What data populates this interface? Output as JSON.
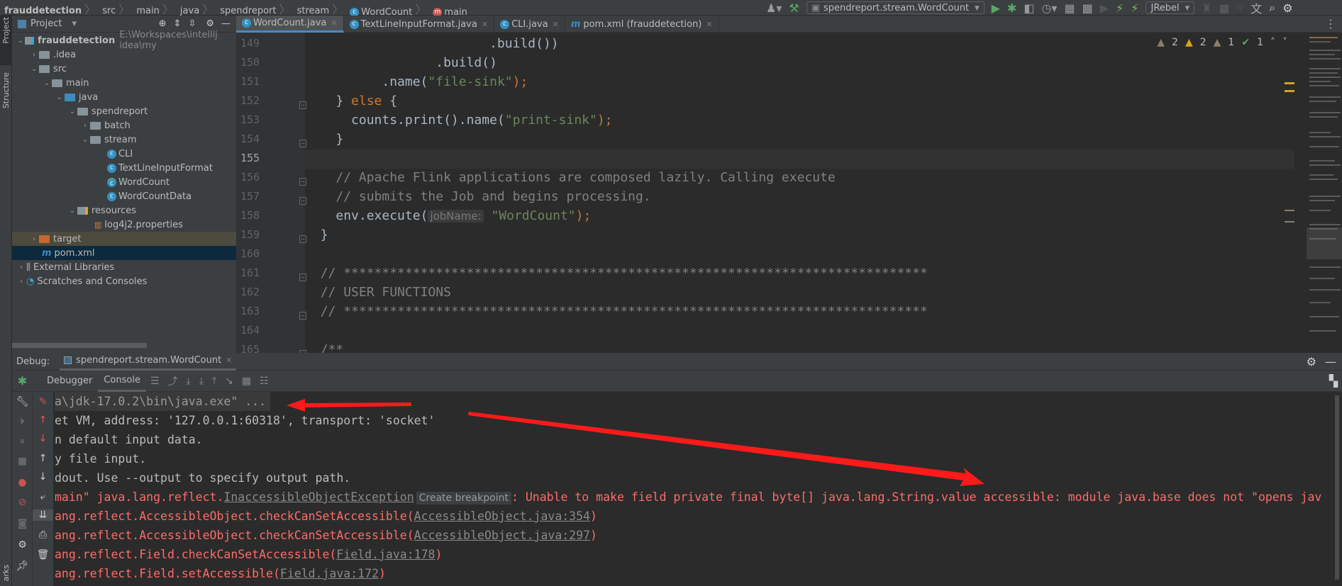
{
  "breadcrumb": [
    "frauddetection",
    "src",
    "main",
    "java",
    "spendreport",
    "stream",
    "WordCount",
    "main"
  ],
  "toolbar": {
    "run_config": "spendreport.stream.WordCount",
    "jrebel": "JRebel"
  },
  "sidebar": {
    "project_label": "Project",
    "structure_label": "Structure",
    "bookmarks_label": "arks"
  },
  "project": {
    "title": "Project",
    "tree": [
      {
        "label": "frauddetection",
        "path": "E:\\Workspaces\\intellij idea\\my"
      },
      {
        "label": ".idea"
      },
      {
        "label": "src"
      },
      {
        "label": "main"
      },
      {
        "label": "java"
      },
      {
        "label": "spendreport"
      },
      {
        "label": "batch"
      },
      {
        "label": "stream"
      },
      {
        "label": "CLI"
      },
      {
        "label": "TextLineInputFormat"
      },
      {
        "label": "WordCount"
      },
      {
        "label": "WordCountData"
      },
      {
        "label": "resources"
      },
      {
        "label": "log4j2.properties"
      },
      {
        "label": "target"
      },
      {
        "label": "pom.xml"
      },
      {
        "label": "External Libraries"
      },
      {
        "label": "Scratches and Consoles"
      }
    ]
  },
  "tabs": [
    {
      "label": "WordCount.java",
      "active": true
    },
    {
      "label": "TextLineInputFormat.java"
    },
    {
      "label": "CLI.java"
    },
    {
      "label": "pom.xml (frauddetection)"
    }
  ],
  "inspections": {
    "warn1": "2",
    "warn2": "2",
    "weak": "1",
    "typo": "1"
  },
  "editor": {
    "line_numbers": [
      "149",
      "150",
      "151",
      "152",
      "153",
      "154",
      "155",
      "156",
      "157",
      "158",
      "159",
      "160",
      "161",
      "162",
      "163",
      "164",
      "165"
    ],
    "code": {
      "l149": ".build())",
      "l150": ".build()",
      "l151a": ".name(",
      "l151s": "\"file-sink\"",
      "l151b": ");",
      "l152a": "} ",
      "l152k": "else",
      "l152b": " {",
      "l153a": "counts.print().name(",
      "l153s": "\"print-sink\"",
      "l153b": ");",
      "l154": "}",
      "l156": "// Apache Flink applications are composed lazily. Calling execute",
      "l157": "// submits the Job and begins processing.",
      "l158a": "env.execute(",
      "l158h": "jobName:",
      "l158s": "\"WordCount\"",
      "l158b": ");",
      "l159": "}",
      "l161": "// ****************************************************************************",
      "l162": "// USER FUNCTIONS",
      "l163": "// ****************************************************************************",
      "l165": "/**"
    }
  },
  "debug": {
    "label": "Debug:",
    "session": "spendreport.stream.WordCount",
    "tabs": [
      "Debugger",
      "Console"
    ],
    "console": {
      "l1": "a\\jdk-17.0.2\\bin\\java.exe\" ...",
      "l2": "et VM, address: '127.0.0.1:60318', transport: 'socket'",
      "l3": "n default input data.",
      "l4": "y file input.",
      "l5": "dout. Use --output to specify output path.",
      "l6a": "main\" java.lang.reflect.",
      "l6link": "InaccessibleObjectException",
      "l6tip": "Create breakpoint",
      "l6b": ": Unable to make field private final byte[] java.lang.String.value accessible: module java.base does not \"opens jav",
      "l7a": "ang.reflect.AccessibleObject.checkCanSetAccessible(",
      "l7link": "AccessibleObject.java:354",
      "l7b": ")",
      "l8a": "ang.reflect.AccessibleObject.checkCanSetAccessible(",
      "l8link": "AccessibleObject.java:297",
      "l8b": ")",
      "l9a": "ang.reflect.Field.checkCanSetAccessible(",
      "l9link": "Field.java:178",
      "l9b": ")",
      "l10a": "ang.reflect.Field.setAccessible(",
      "l10link": "Field.java:172",
      "l10b": ")"
    }
  },
  "colors": {
    "error": "#ff6b68",
    "accent": "#4a88c7",
    "annotation": "#ff1a1a"
  }
}
